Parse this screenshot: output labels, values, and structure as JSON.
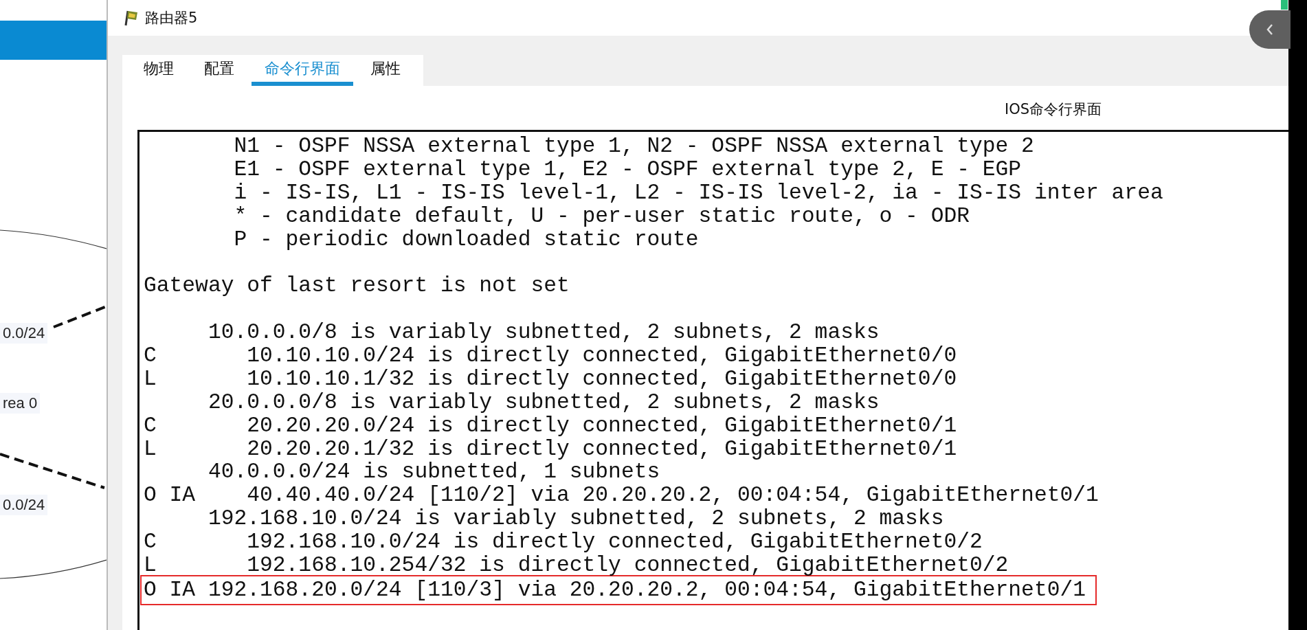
{
  "diagram": {
    "labels": [
      "0.0/24",
      "rea 0",
      "0.0/24"
    ]
  },
  "window": {
    "title": "路由器5"
  },
  "tabs": [
    {
      "label": "物理",
      "selected": false
    },
    {
      "label": "配置",
      "selected": false
    },
    {
      "label": "命令行界面",
      "selected": true
    },
    {
      "label": "属性",
      "selected": false
    }
  ],
  "panel_title": "IOS命令行界面",
  "console": {
    "blocks": [
      {
        "lines": [
          {
            "text": "       N1 - OSPF NSSA external type 1, N2 - OSPF NSSA external type 2",
            "highlighted": false
          },
          {
            "text": "       E1 - OSPF external type 1, E2 - OSPF external type 2, E - EGP",
            "highlighted": false
          },
          {
            "text": "       i - IS-IS, L1 - IS-IS level-1, L2 - IS-IS level-2, ia - IS-IS inter area",
            "highlighted": false
          },
          {
            "text": "       * - candidate default, U - per-user static route, o - ODR",
            "highlighted": false
          },
          {
            "text": "       P - periodic downloaded static route",
            "highlighted": false
          }
        ]
      },
      {
        "lines": [
          {
            "text": "Gateway of last resort is not set",
            "highlighted": false
          }
        ]
      },
      {
        "lines": [
          {
            "text": "     10.0.0.0/8 is variably subnetted, 2 subnets, 2 masks",
            "highlighted": false
          },
          {
            "text": "C       10.10.10.0/24 is directly connected, GigabitEthernet0/0",
            "highlighted": false
          },
          {
            "text": "L       10.10.10.1/32 is directly connected, GigabitEthernet0/0",
            "highlighted": false
          },
          {
            "text": "     20.0.0.0/8 is variably subnetted, 2 subnets, 2 masks",
            "highlighted": false
          },
          {
            "text": "C       20.20.20.0/24 is directly connected, GigabitEthernet0/1",
            "highlighted": false
          },
          {
            "text": "L       20.20.20.1/32 is directly connected, GigabitEthernet0/1",
            "highlighted": false
          },
          {
            "text": "     40.0.0.0/24 is subnetted, 1 subnets",
            "highlighted": false
          },
          {
            "text": "O IA    40.40.40.0/24 [110/2] via 20.20.20.2, 00:04:54, GigabitEthernet0/1",
            "highlighted": false
          },
          {
            "text": "     192.168.10.0/24 is variably subnetted, 2 subnets, 2 masks",
            "highlighted": false
          },
          {
            "text": "C       192.168.10.0/24 is directly connected, GigabitEthernet0/2",
            "highlighted": false
          },
          {
            "text": "L       192.168.10.254/32 is directly connected, GigabitEthernet0/2",
            "highlighted": false
          },
          {
            "text": "O IA 192.168.20.0/24 [110/3] via 20.20.20.2, 00:04:54, GigabitEthernet0/1",
            "highlighted": true
          }
        ]
      }
    ]
  }
}
